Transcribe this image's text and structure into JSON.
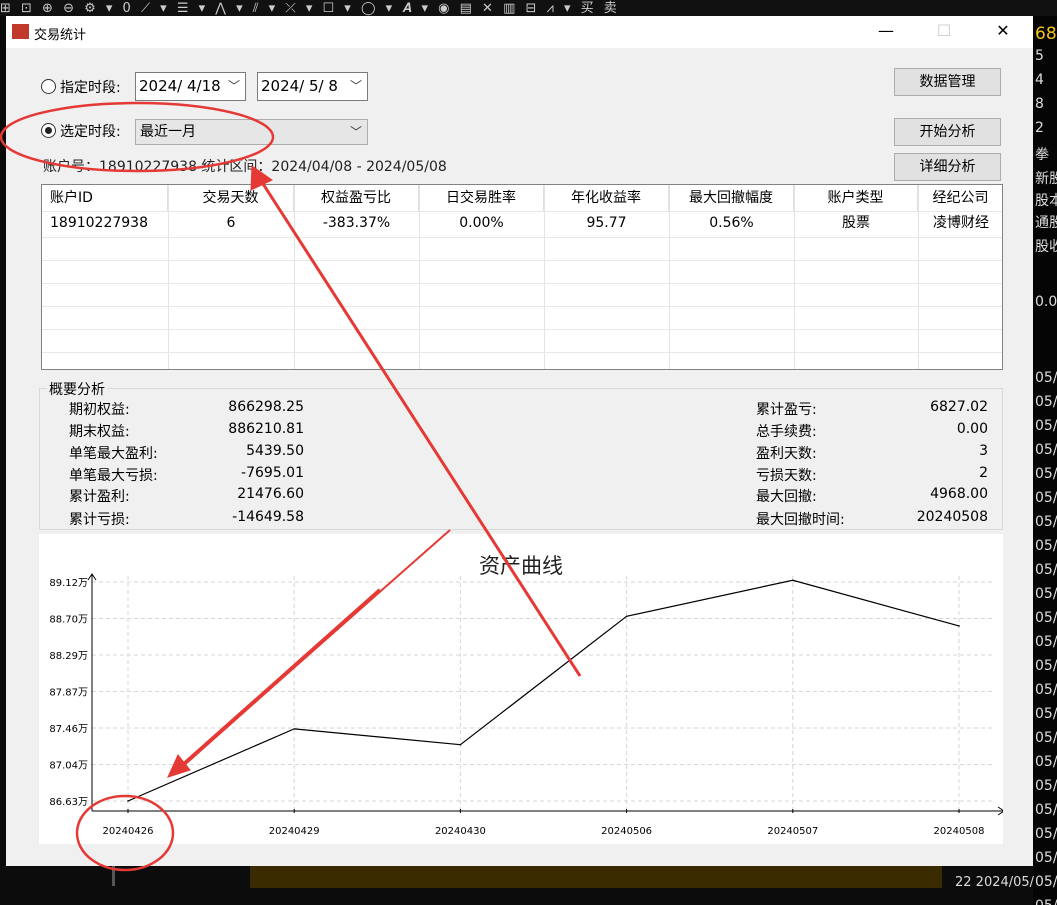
{
  "toolbar": {
    "chars": "⊞ ⊡ ⊕ ⊖ ⚙ ▾ 0 ⟋ ▾ ☰ ▾ ⋀ ▾ ⫽ ▾ ⤫ ▾ ☐ ▾ ◯ ▾ 𝑨 ▾ ◉ ▤ ✕ ▥ ⊟ ⩘ ▾ 买 卖"
  },
  "background_right": [
    "68",
    "5",
    "4",
    "8",
    "2",
    "拳",
    "新股",
    "股本",
    "通股",
    "股收",
    "",
    "0.0",
    "",
    "05/",
    "05/",
    "05/",
    "05/",
    "05/",
    "05/",
    "05/",
    "05/",
    "05/",
    "05/",
    "05/",
    "05/",
    "05/",
    "05/",
    "05/",
    "05/",
    "05/",
    "05/",
    "05/",
    "05/",
    "05/",
    "05/",
    "05/"
  ],
  "background_bottom": {
    "text": "22    2024/05/"
  },
  "window": {
    "title": "交易统计",
    "minimize": "—",
    "maximize": "☐",
    "close": "✕"
  },
  "period": {
    "specify_label": "指定时段:",
    "start_date": "2024/  4/18",
    "end_date": "2024/  5/  8",
    "select_label": "选定时段:",
    "select_value": "最近一月",
    "selected_option": "select"
  },
  "buttons": {
    "data_manage": "数据管理",
    "start_analysis": "开始分析",
    "detail_analysis": "详细分析"
  },
  "account_info": "账户号：18910227938   统计区间：2024/04/08 - 2024/05/08",
  "table": {
    "headers": [
      "账户ID",
      "交易天数",
      "权益盈亏比",
      "日交易胜率",
      "年化收益率",
      "最大回撤幅度",
      "账户类型",
      "经纪公司"
    ],
    "rows": [
      [
        "18910227938",
        "6",
        "-383.37%",
        "0.00%",
        "95.77",
        "0.56%",
        "股票",
        "凌博财经"
      ]
    ]
  },
  "summary": {
    "title": "概要分析",
    "left": [
      {
        "label": "期初权益:",
        "value": "866298.25"
      },
      {
        "label": "期末权益:",
        "value": "886210.81"
      },
      {
        "label": "单笔最大盈利:",
        "value": "5439.50"
      },
      {
        "label": "单笔最大亏损:",
        "value": "-7695.01"
      },
      {
        "label": "累计盈利:",
        "value": "21476.60"
      },
      {
        "label": "累计亏损:",
        "value": "-14649.58"
      }
    ],
    "right": [
      {
        "label": "累计盈亏:",
        "value": "6827.02"
      },
      {
        "label": "总手续费:",
        "value": "0.00"
      },
      {
        "label": "盈利天数:",
        "value": "3"
      },
      {
        "label": "亏损天数:",
        "value": "2"
      },
      {
        "label": "最大回撤:",
        "value": "4968.00"
      },
      {
        "label": "最大回撤时间:",
        "value": "20240508"
      }
    ]
  },
  "chart_data": {
    "type": "line",
    "title": "资产曲线",
    "categories": [
      "20240426",
      "20240429",
      "20240430",
      "20240506",
      "20240507",
      "20240508"
    ],
    "values": [
      86.63,
      87.45,
      87.27,
      88.73,
      89.14,
      88.62
    ],
    "y_unit": "万",
    "y_ticks": [
      "86.63万",
      "87.04万",
      "87.46万",
      "87.87万",
      "88.29万",
      "88.70万",
      "89.12万"
    ],
    "ylim": [
      86.63,
      89.12
    ],
    "grid": true,
    "line_color": "#000000"
  },
  "annotation_color": "#e53935"
}
